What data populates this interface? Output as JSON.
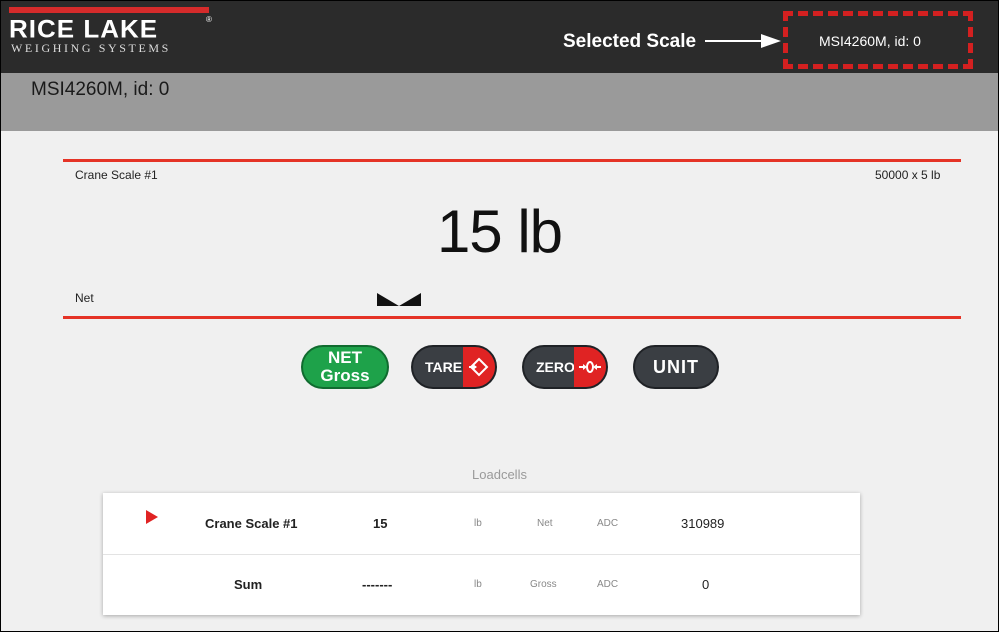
{
  "header": {
    "logo_main": "RICE LAKE",
    "logo_registered": "®",
    "logo_sub": "WEIGHING SYSTEMS",
    "callout_label": "Selected Scale",
    "selected_scale": "MSI4260M, id: 0"
  },
  "title": "MSI4260M, id: 0",
  "scale": {
    "name": "Crane Scale #1",
    "capacity": "50000 x 5 lb",
    "weight_display": "15 lb",
    "mode": "Net"
  },
  "buttons": {
    "net_line1": "NET",
    "net_line2": "Gross",
    "tare": "TARE",
    "zero": "ZERO",
    "unit": "UNIT"
  },
  "loadcells": {
    "title": "Loadcells",
    "rows": [
      {
        "name": "Crane Scale #1",
        "value": "15",
        "unit": "lb",
        "mode": "Net",
        "adc_label": "ADC",
        "adc": "310989",
        "selected": true
      },
      {
        "name": "Sum",
        "value": "-------",
        "unit": "lb",
        "mode": "Gross",
        "adc_label": "ADC",
        "adc": "0",
        "selected": false
      }
    ]
  },
  "colors": {
    "accent_red": "#e53326",
    "net_green": "#1ea24a",
    "button_dark": "#3a3e43",
    "header_bg": "#2b2b2b"
  }
}
